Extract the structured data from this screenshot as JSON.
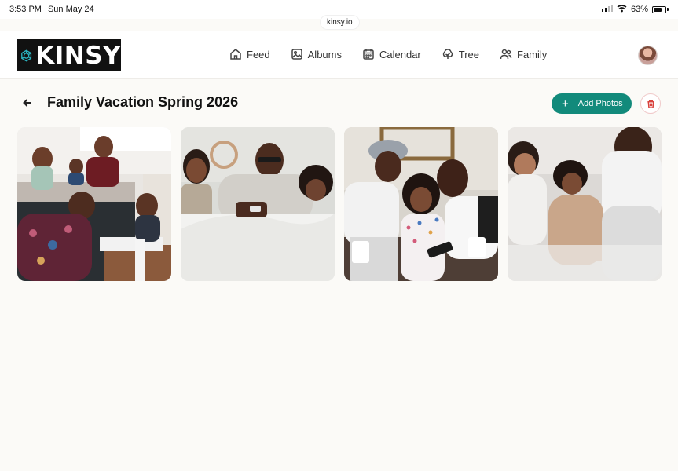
{
  "status_bar": {
    "time": "3:53 PM",
    "date": "Sun May 24",
    "url": "kinsy.io",
    "battery": "63%"
  },
  "brand": {
    "name": "KINSY",
    "accent": "#2bb3c0"
  },
  "nav": {
    "items": [
      {
        "label": "Feed",
        "icon": "home-icon"
      },
      {
        "label": "Albums",
        "icon": "albums-icon"
      },
      {
        "label": "Calendar",
        "icon": "calendar-icon"
      },
      {
        "label": "Tree",
        "icon": "tree-icon"
      },
      {
        "label": "Family",
        "icon": "family-icon"
      }
    ]
  },
  "album": {
    "title": "Family Vacation Spring 2026",
    "add_photos_label": "Add Photos",
    "photos": [
      {
        "icon": "family-kitchen-photo"
      },
      {
        "icon": "family-bed-photo"
      },
      {
        "icon": "family-couch-photo"
      },
      {
        "icon": "family-cuddle-photo"
      }
    ]
  },
  "colors": {
    "primary": "#128a7b",
    "danger": "#d9423d",
    "background": "#fbfaf7"
  }
}
